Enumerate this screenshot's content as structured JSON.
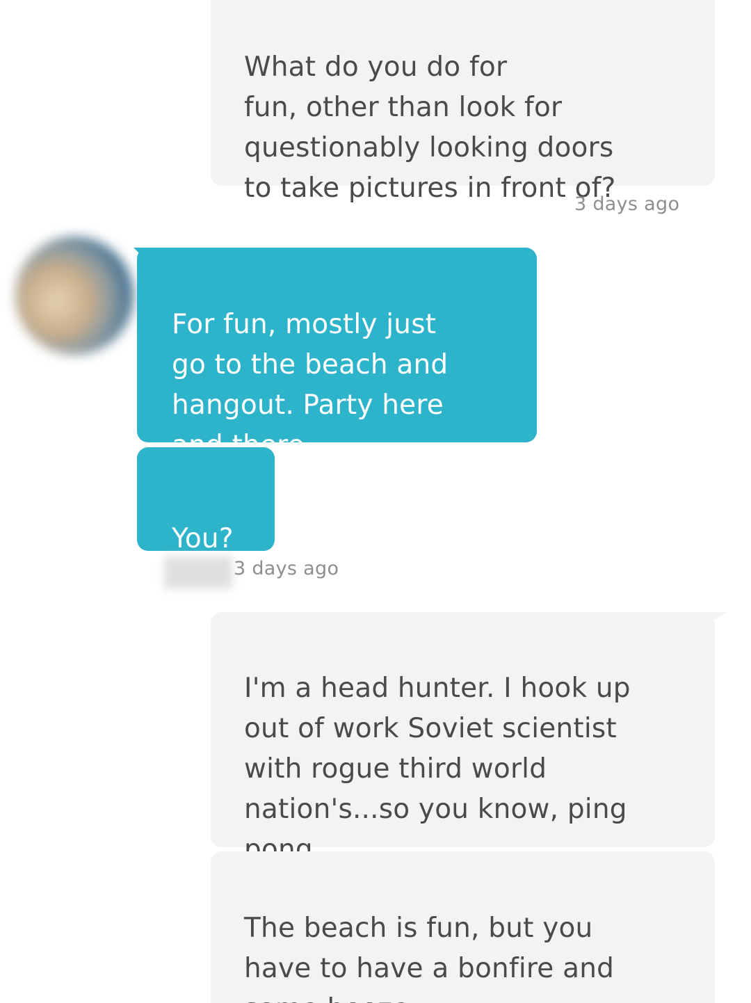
{
  "messages": [
    {
      "sender": "me",
      "text": "What do you do for\nfun, other than look for\nquestionably looking doors\nto take pictures in front of?"
    },
    {
      "sender": "match",
      "text": "For fun, mostly just\ngo to the beach and\nhangout. Party here\nand there"
    },
    {
      "sender": "match",
      "text": "You?"
    },
    {
      "sender": "me",
      "text": "I'm a head hunter. I hook up\nout of work Soviet scientist\nwith rogue third world\nnation's...so you know, ping\npong"
    },
    {
      "sender": "me",
      "text": "The beach is fun, but you\nhave to have a bonfire and\nsome booze"
    }
  ],
  "timestamps": {
    "sent_1": "3 days ago",
    "received_1": "3 days ago"
  },
  "colors": {
    "sent_bubble": "#f3f3f3",
    "sent_text": "#4a4a4a",
    "received_bubble": "#2db3ca",
    "received_text": "#ffffff",
    "timestamp": "#8e8e8e"
  },
  "icons": {
    "avatar": "avatar-blurred"
  }
}
